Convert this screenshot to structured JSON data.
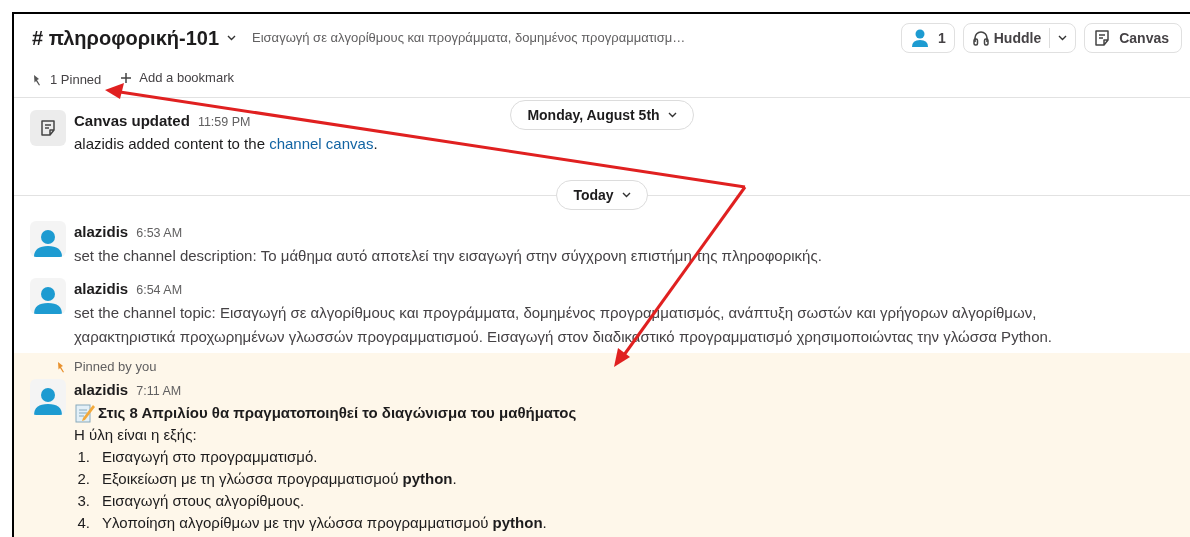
{
  "header": {
    "channel": "# πληροφορική-101",
    "topic": "Εισαγωγή σε αλγορίθμους και προγράμματα, δομημένος προγραμματισμ…",
    "members": "1",
    "huddle": "Huddle",
    "canvas": "Canvas"
  },
  "bookmarks": {
    "pinned": "1 Pinned",
    "add": "Add a bookmark"
  },
  "messages": [
    {
      "kind": "canvas",
      "author": "Canvas updated",
      "time": "11:59 PM",
      "date_label": "Monday, August 5th",
      "text": "alazidis added content to the ",
      "link": "channel canvas",
      "after": "."
    },
    {
      "kind": "divider",
      "label": "Today"
    },
    {
      "kind": "user",
      "author": "alazidis",
      "time": "6:53 AM",
      "text": "set the channel description: Το μάθημα αυτό αποτελεί την εισαγωγή στην σύγχρονη επιστήμη της πληροφορικής."
    },
    {
      "kind": "user",
      "author": "alazidis",
      "time": "6:54 AM",
      "text": "set the channel topic: Εισαγωγή σε αλγορίθμους και προγράμματα, δομημένος προγραμματισμός, ανάπτυξη σωστών και γρήγορων αλγορίθμων, χαρακτηριστικά προχωρημένων γλωσσών προγραμματισμού. Εισαγωγή στον διαδικαστικό προγραμματισμό χρησιμοποιώντας την γλώσσα Python."
    },
    {
      "kind": "post",
      "author": "alazidis",
      "time": "7:11 AM",
      "pinned": true,
      "pinned_label": "Pinned by you",
      "title": "Στις 8 Απριλίου θα πραγματοποιηθεί το διαγώνισμα του μαθήματος",
      "intro": "Η ύλη είναι η εξής:",
      "list": [
        {
          "num": "1.",
          "text": "Εισαγωγή στο προγραμματισμό."
        },
        {
          "num": "2.",
          "text": "Εξοικείωση με τη γλώσσα προγραμματισμού **python**."
        },
        {
          "num": "3.",
          "text": "Εισαγωγή στους αλγορίθμους."
        },
        {
          "num": "4.",
          "text": "Υλοποίηση αλγορίθμων με την γλώσσα προγραμματισμού **python**."
        }
      ]
    }
  ]
}
